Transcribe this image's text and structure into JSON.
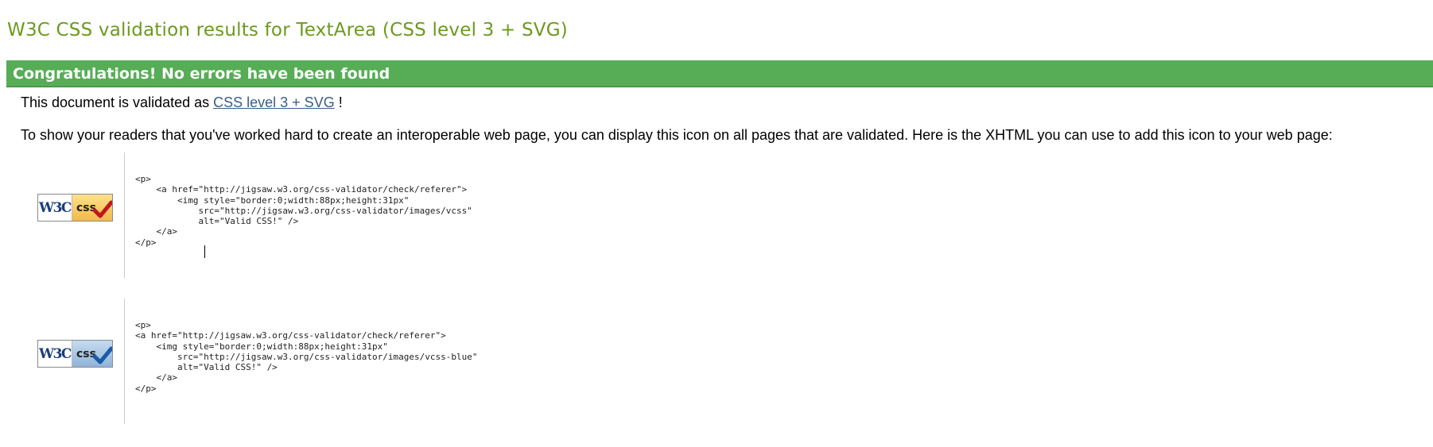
{
  "page": {
    "title": "W3C CSS validation results for TextArea (CSS level 3 + SVG)"
  },
  "banner": {
    "text": "Congratulations! No errors have been found"
  },
  "validated": {
    "prefix": "This document is validated as ",
    "link_text": "CSS level 3 + SVG",
    "suffix": " !"
  },
  "readers_text": "To show your readers that you've worked hard to create an interoperable web page, you can display this icon on all pages that are validated. Here is the XHTML you can use to add this icon to your web page:",
  "badges": [
    {
      "w3c": "W3C",
      "css": "css",
      "style": "gold",
      "check_color": "#c0171f",
      "code": "<p>\n    <a href=\"http://jigsaw.w3.org/css-validator/check/referer\">\n        <img style=\"border:0;width:88px;height:31px\"\n            src=\"http://jigsaw.w3.org/css-validator/images/vcss\"\n            alt=\"Valid CSS!\" />\n    </a>\n</p>"
    },
    {
      "w3c": "W3C",
      "css": "css",
      "style": "blue",
      "check_color": "#1a5aa6",
      "code": "<p>\n<a href=\"http://jigsaw.w3.org/css-validator/check/referer\">\n    <img style=\"border:0;width:88px;height:31px\"\n        src=\"http://jigsaw.w3.org/css-validator/images/vcss-blue\"\n        alt=\"Valid CSS!\" />\n    </a>\n</p>"
    }
  ],
  "colors": {
    "title": "#6c9a1d",
    "banner_bg": "#56ad56",
    "link": "#3a5d88"
  }
}
